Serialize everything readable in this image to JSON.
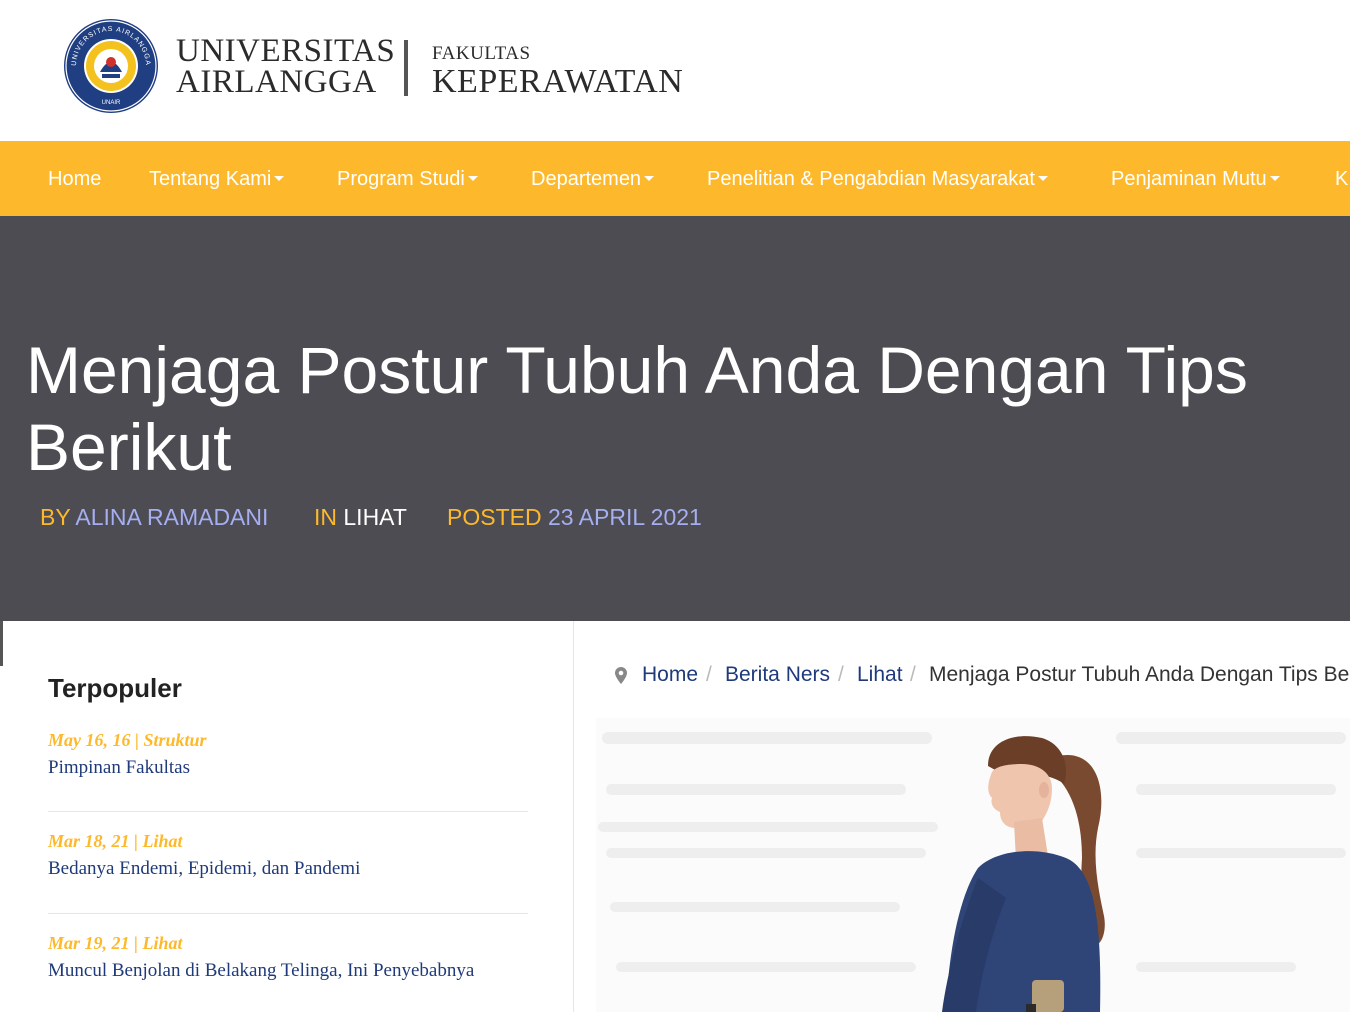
{
  "header": {
    "logo_univ_line1": "UNIVERSITAS",
    "logo_univ_line2": "AIRLANGGA",
    "logo_fak_line1": "FAKULTAS",
    "logo_fak_line2": "KEPERAWATAN",
    "seal_text": "UNIVERSITAS AIRLANGGA",
    "seal_bottom": "UNAIR"
  },
  "nav": {
    "items": [
      {
        "label": "Home",
        "has_dropdown": false
      },
      {
        "label": "Tentang Kami",
        "has_dropdown": true
      },
      {
        "label": "Program Studi",
        "has_dropdown": true
      },
      {
        "label": "Departemen",
        "has_dropdown": true
      },
      {
        "label": "Penelitian & Pengabdian Masyarakat",
        "has_dropdown": true
      },
      {
        "label": "Penjaminan Mutu",
        "has_dropdown": true
      },
      {
        "label": "K",
        "has_dropdown": false
      }
    ]
  },
  "article": {
    "title": "Menjaga Postur Tubuh Anda Dengan Tips Berikut",
    "by_label": "BY",
    "author": "ALINA RAMADANI",
    "in_label": "IN",
    "category": "LIHAT",
    "posted_label": "POSTED",
    "date": "23 APRIL 2021"
  },
  "sidebar": {
    "title": "Terpopuler",
    "items": [
      {
        "meta": "May 16, 16 | Struktur",
        "title": "Pimpinan Fakultas"
      },
      {
        "meta": "Mar 18, 21 | Lihat",
        "title": "Bedanya Endemi, Epidemi, dan Pandemi"
      },
      {
        "meta": "Mar 19, 21 | Lihat",
        "title": "Muncul Benjolan di Belakang Telinga, Ini Penyebabnya"
      }
    ]
  },
  "breadcrumb": {
    "items": [
      "Home",
      "Berita Ners",
      "Lihat"
    ],
    "separator": "/",
    "current": "Menjaga Postur Tubuh Anda Dengan Tips Be"
  },
  "colors": {
    "accent": "#fdb92b",
    "hero_bg": "#4d4c52",
    "link": "#1f3a7a",
    "meta_value": "#a4aef1"
  },
  "icons": {
    "breadcrumb": "map-pin-icon",
    "dropdown": "caret-down-icon",
    "seal": "university-seal-icon"
  }
}
